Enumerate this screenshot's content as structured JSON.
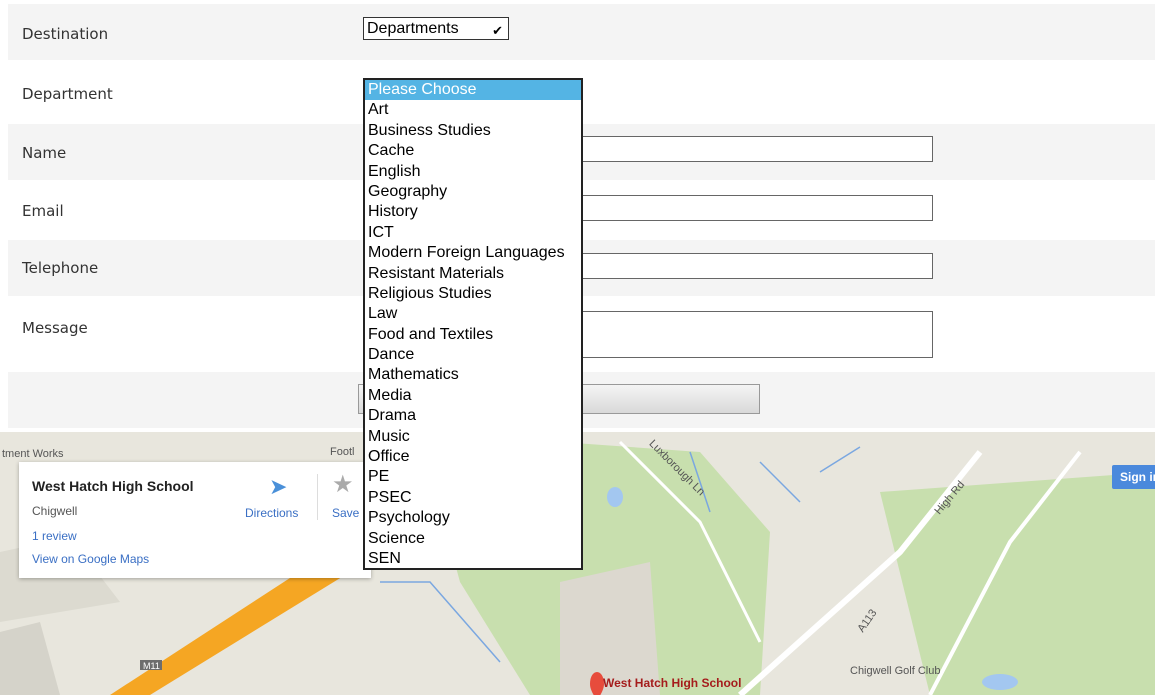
{
  "form": {
    "destination_label": "Destination",
    "destination_value": "Departments",
    "department_label": "Department",
    "name_label": "Name",
    "email_label": "Email",
    "telephone_label": "Telephone",
    "message_label": "Message"
  },
  "dropdown": {
    "selected": "Please Choose",
    "options": [
      "Please Choose",
      "Art",
      "Business Studies",
      "Cache",
      "English",
      "Geography",
      "History",
      "ICT",
      "Modern Foreign Languages",
      "Resistant Materials",
      "Religious Studies",
      "Law",
      "Food and Textiles",
      "Dance",
      "Mathematics",
      "Media",
      "Drama",
      "Music",
      "Office",
      "PE",
      "PSEC",
      "Psychology",
      "Science",
      "SEN"
    ]
  },
  "map": {
    "place_name": "West Hatch High School",
    "place_locality": "Chigwell",
    "reviews": "1 review",
    "view_link": "View on Google Maps",
    "directions_label": "Directions",
    "save_label": "Save",
    "signin_label": "Sign in",
    "labels": {
      "treatment_works": "tment Works",
      "foot": "Footl",
      "luxborough": "Luxborough Ln",
      "high_rd": "High Rd",
      "a113": "A113",
      "m11": "M11",
      "golf_club": "Chigwell Golf Club",
      "pin_label": "West Hatch High School"
    },
    "colors": {
      "motorway": "#f5a623",
      "pin": "#e74c3c",
      "green": "#c8dfae",
      "water": "#a3c7f0"
    }
  }
}
